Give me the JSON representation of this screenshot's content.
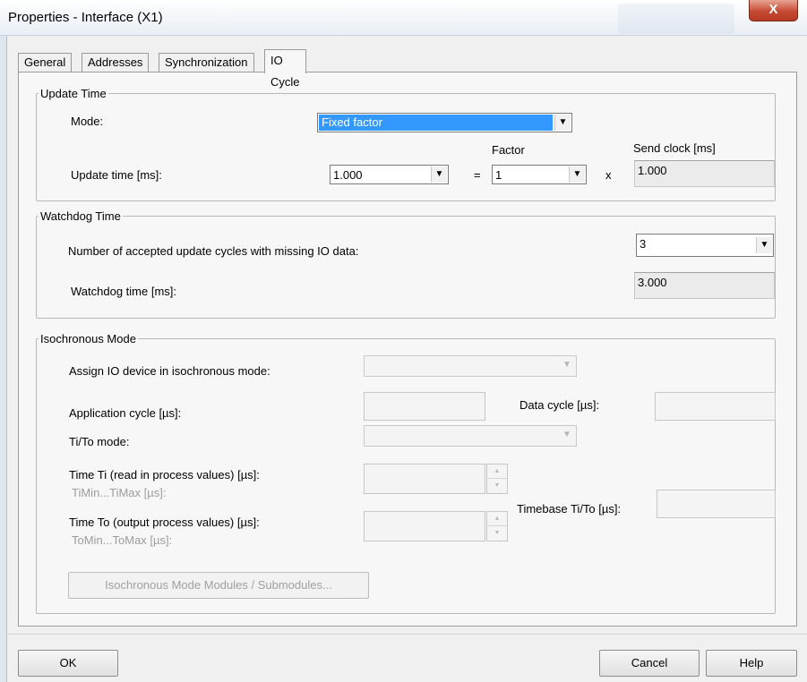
{
  "window": {
    "title": "Properties - Interface (X1)",
    "close_glyph": "X"
  },
  "tabs": [
    {
      "label": "General",
      "active": false
    },
    {
      "label": "Addresses",
      "active": false
    },
    {
      "label": "Synchronization",
      "active": false
    },
    {
      "label": "IO Cycle",
      "active": true
    }
  ],
  "update_time": {
    "legend": "Update Time",
    "mode_label": "Mode:",
    "mode_value": "Fixed factor",
    "update_time_label": "Update time [ms]:",
    "update_time_value": "1.000",
    "equals": "=",
    "factor_label": "Factor",
    "factor_value": "1",
    "times": "x",
    "send_clock_label": "Send clock [ms]",
    "send_clock_value": "1.000"
  },
  "watchdog": {
    "legend": "Watchdog Time",
    "accepted_cycles_label": "Number of accepted update cycles with missing IO data:",
    "accepted_cycles_value": "3",
    "watchdog_time_label": "Watchdog time [ms]:",
    "watchdog_time_value": "3.000"
  },
  "isochronous": {
    "legend": "Isochronous Mode",
    "assign_label": "Assign IO device in isochronous mode:",
    "application_cycle_label": "Application cycle [µs]:",
    "data_cycle_label": "Data cycle [µs]:",
    "ti_to_mode_label": "Ti/To mode:",
    "time_ti_label": "Time Ti (read in process values) [µs]:",
    "ti_range_label": "TiMin...TiMax [µs]:",
    "time_to_label": "Time To (output process values) [µs]:",
    "to_range_label": "ToMin...ToMax [µs]:",
    "timebase_label": "Timebase Ti/To [µs]:",
    "modules_button": "Isochronous Mode Modules / Submodules..."
  },
  "footer": {
    "ok": "OK",
    "cancel": "Cancel",
    "help": "Help"
  }
}
